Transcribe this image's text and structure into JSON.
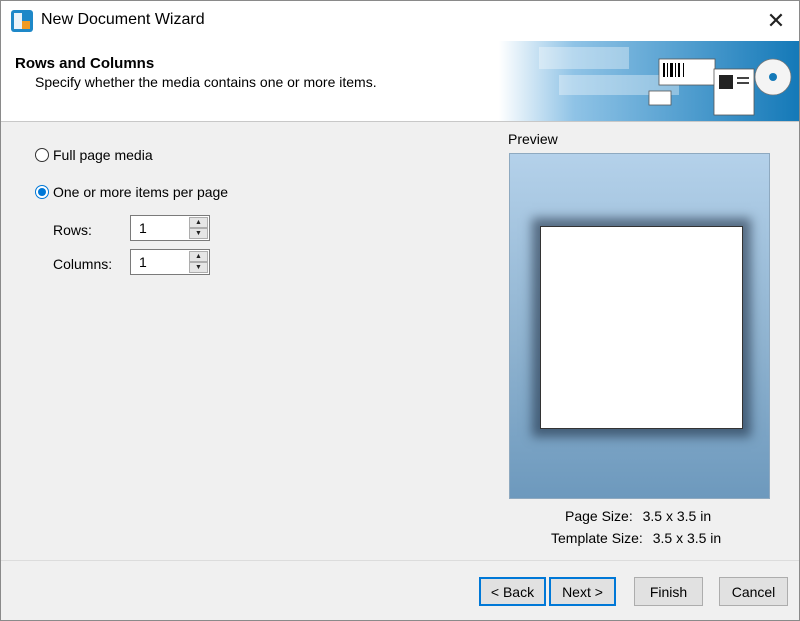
{
  "window": {
    "title": "New Document Wizard",
    "close_symbol": "✕"
  },
  "header": {
    "title": "Rows and Columns",
    "subtitle": "Specify whether the media contains one or more items."
  },
  "options": {
    "full_page": {
      "label": "Full page media",
      "checked": false
    },
    "multi_items": {
      "label": "One or more items per page",
      "checked": true
    }
  },
  "fields": {
    "rows": {
      "label": "Rows:",
      "value": "1"
    },
    "columns": {
      "label": "Columns:",
      "value": "1"
    }
  },
  "preview": {
    "label": "Preview",
    "page_size_label": "Page Size:",
    "page_size_value": "3.5 x 3.5 in",
    "template_size_label": "Template Size:",
    "template_size_value": "3.5 x 3.5 in"
  },
  "buttons": {
    "back": "< Back",
    "next": "Next >",
    "finish": "Finish",
    "cancel": "Cancel"
  }
}
